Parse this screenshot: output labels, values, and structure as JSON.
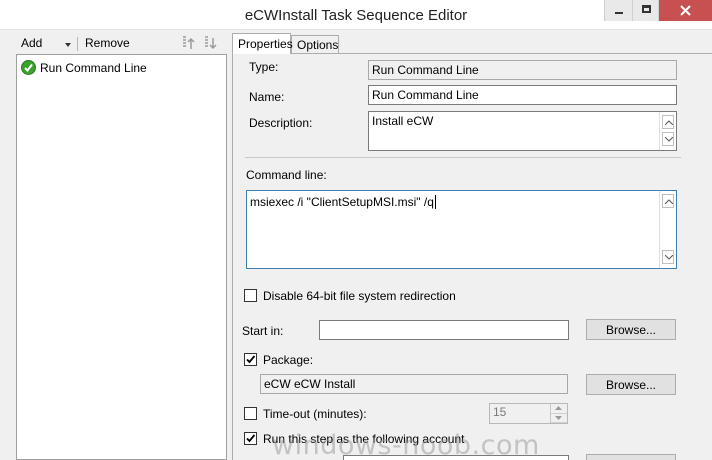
{
  "window": {
    "title": "eCWInstall Task Sequence Editor"
  },
  "toolbar": {
    "add_label": "Add",
    "remove_label": "Remove"
  },
  "tree": {
    "items": [
      {
        "label": "Run Command Line",
        "status": "success"
      }
    ]
  },
  "tabs": [
    {
      "label": "Properties",
      "active": true
    },
    {
      "label": "Options",
      "active": false
    }
  ],
  "properties": {
    "type_label": "Type:",
    "type_value": "Run Command Line",
    "name_label": "Name:",
    "name_value": "Run Command Line",
    "description_label": "Description:",
    "description_value": "Install eCW",
    "command_line_label": "Command line:",
    "command_line_value": "msiexec /i \"ClientSetupMSI.msi\" /q",
    "disable_64bit_label": "Disable 64-bit file system redirection",
    "disable_64bit_checked": false,
    "start_in_label": "Start in:",
    "start_in_value": "",
    "browse_label": "Browse...",
    "package_label": "Package:",
    "package_checked": true,
    "package_value": "eCW eCW Install",
    "timeout_label": "Time-out (minutes):",
    "timeout_checked": false,
    "timeout_value": "15",
    "run_as_label": "Run this step as the following account",
    "run_as_checked": true
  },
  "watermark": "windows-noob.com",
  "colors": {
    "close_button": "#c75050",
    "success_icon": "#3ba02c"
  }
}
